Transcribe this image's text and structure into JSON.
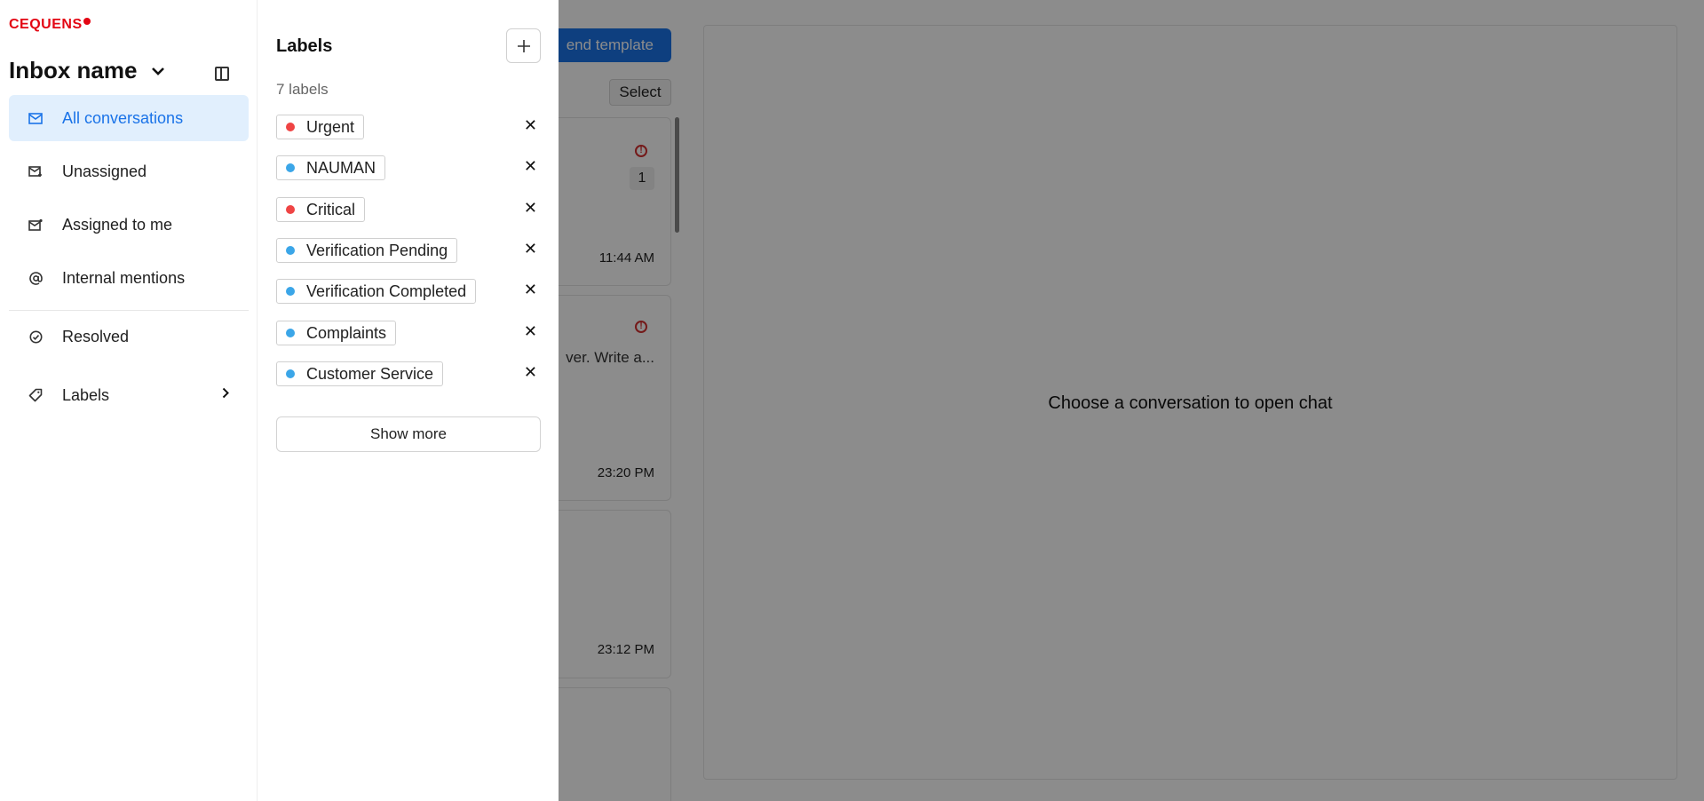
{
  "background": {
    "send_template_label": "end template",
    "select_label": "Select",
    "conversations": [
      {
        "time": "11:44 AM",
        "preview": "",
        "has_alert": true,
        "count": "1"
      },
      {
        "time": "23:20 PM",
        "preview": "ver. Write a...",
        "has_alert": true,
        "count": ""
      },
      {
        "time": "23:12 PM",
        "preview": "",
        "has_alert": false,
        "count": ""
      }
    ],
    "chat_empty_text": "Choose a conversation to open chat"
  },
  "sidebar": {
    "logo": "CEQUENS",
    "inbox_name": "Inbox name",
    "items": [
      {
        "label": "All conversations",
        "icon": "mail-icon"
      },
      {
        "label": "Unassigned",
        "icon": "mail-unassigned-icon"
      },
      {
        "label": "Assigned to me",
        "icon": "mail-assigned-icon"
      },
      {
        "label": "Internal mentions",
        "icon": "at-icon"
      },
      {
        "label": "Resolved",
        "icon": "check-circle-icon"
      },
      {
        "label": "Labels",
        "icon": "tag-icon"
      }
    ]
  },
  "labels_panel": {
    "title": "Labels",
    "count_text": "7 labels",
    "labels": [
      {
        "name": "Urgent",
        "color": "#ef4444"
      },
      {
        "name": "NAUMAN",
        "color": "#3ba6e8"
      },
      {
        "name": "Critical",
        "color": "#ef4444"
      },
      {
        "name": "Verification Pending",
        "color": "#3ba6e8"
      },
      {
        "name": "Verification Completed",
        "color": "#3ba6e8"
      },
      {
        "name": "Complaints",
        "color": "#3ba6e8"
      },
      {
        "name": "Customer Service",
        "color": "#3ba6e8"
      }
    ],
    "show_more_label": "Show more"
  },
  "colors": {
    "accent": "#1a73e8",
    "brand": "#e30613",
    "active_bg": "#e1effd"
  }
}
